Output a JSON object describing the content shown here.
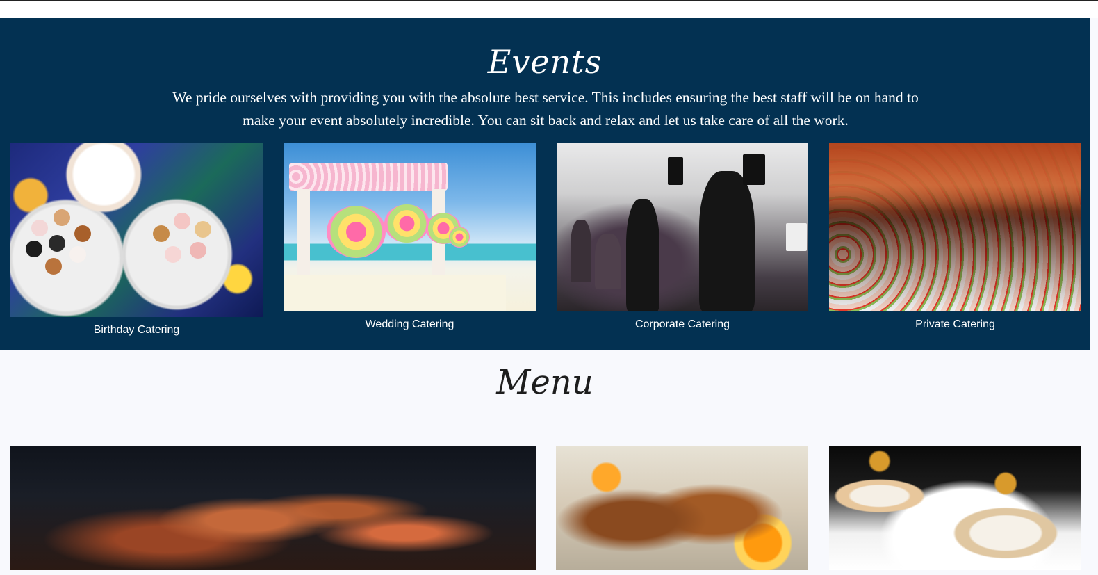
{
  "events": {
    "title": "Events",
    "description": "We pride ourselves with providing you with the absolute best service. This includes ensuring the best staff will be on hand to make your event absolutely incredible. You can sit back and relax and let us take care of all the work.",
    "cards": [
      {
        "label": "Birthday Catering"
      },
      {
        "label": "Wedding Catering"
      },
      {
        "label": "Corporate Catering"
      },
      {
        "label": "Private Catering"
      }
    ]
  },
  "menu": {
    "title": "Menu"
  },
  "colors": {
    "events_background": "#033152",
    "page_background": "#f8f9fd"
  }
}
